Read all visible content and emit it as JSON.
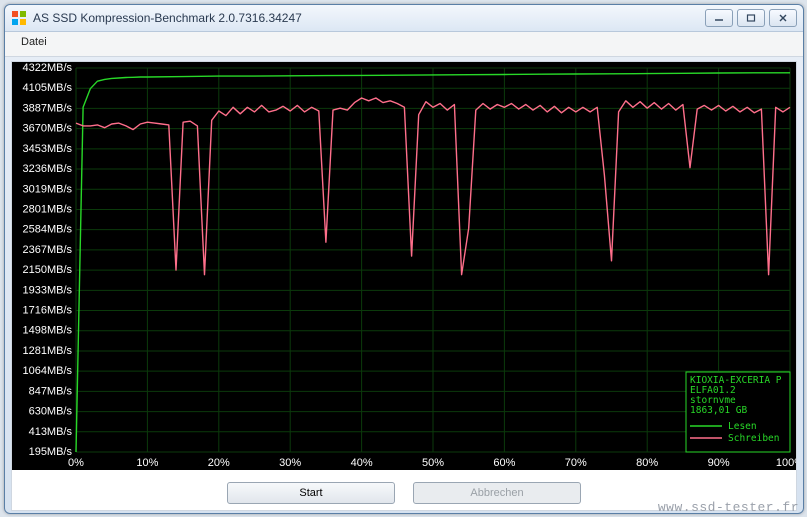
{
  "window": {
    "title": "AS SSD Kompression-Benchmark 2.0.7316.34247"
  },
  "menu": {
    "file": "Datei"
  },
  "buttons": {
    "start": "Start",
    "abort": "Abbrechen"
  },
  "watermark": "www.ssd-tester.fr",
  "legend": {
    "device_line1": "KIOXIA-EXCERIA P",
    "device_line2": "ELFA01.2",
    "driver": "stornvme",
    "capacity": "1863,01 GB",
    "read": "Lesen",
    "write": "Schreiben"
  },
  "colors": {
    "read": "#28d828",
    "write": "#ff6f8b",
    "grid": "#0b3a0b",
    "axis_text": "#ffffff",
    "legend_text": "#28d828"
  },
  "chart_data": {
    "type": "line",
    "title": "",
    "xlabel": "",
    "ylabel": "",
    "x_ticks": [
      "0%",
      "10%",
      "20%",
      "30%",
      "40%",
      "50%",
      "60%",
      "70%",
      "80%",
      "90%",
      "100%"
    ],
    "y_ticks": [
      "195MB/s",
      "413MB/s",
      "630MB/s",
      "847MB/s",
      "1064MB/s",
      "1281MB/s",
      "1498MB/s",
      "1716MB/s",
      "1933MB/s",
      "2150MB/s",
      "2367MB/s",
      "2584MB/s",
      "2801MB/s",
      "3019MB/s",
      "3236MB/s",
      "3453MB/s",
      "3670MB/s",
      "3887MB/s",
      "4105MB/s",
      "4322MB/s"
    ],
    "ylim": [
      195,
      4322
    ],
    "xlim": [
      0,
      100
    ],
    "series": [
      {
        "name": "Lesen",
        "color": "#28d828",
        "x": [
          0,
          1,
          2,
          3,
          4,
          5,
          6,
          7,
          8,
          9,
          10,
          15,
          20,
          25,
          30,
          35,
          40,
          45,
          50,
          55,
          60,
          65,
          70,
          75,
          80,
          85,
          90,
          95,
          100
        ],
        "y": [
          195,
          3900,
          4100,
          4180,
          4200,
          4210,
          4215,
          4220,
          4222,
          4225,
          4225,
          4230,
          4235,
          4235,
          4238,
          4240,
          4242,
          4245,
          4248,
          4250,
          4252,
          4255,
          4258,
          4260,
          4262,
          4265,
          4268,
          4270,
          4270
        ]
      },
      {
        "name": "Schreiben",
        "color": "#ff6f8b",
        "x": [
          0,
          1,
          2,
          3,
          4,
          5,
          6,
          7,
          8,
          9,
          10,
          11,
          12,
          13,
          14,
          15,
          16,
          17,
          18,
          19,
          20,
          21,
          22,
          23,
          24,
          25,
          26,
          27,
          28,
          29,
          30,
          31,
          32,
          33,
          34,
          35,
          36,
          37,
          38,
          39,
          40,
          41,
          42,
          43,
          44,
          45,
          46,
          47,
          48,
          49,
          50,
          51,
          52,
          53,
          54,
          55,
          56,
          57,
          58,
          59,
          60,
          61,
          62,
          63,
          64,
          65,
          66,
          67,
          68,
          69,
          70,
          71,
          72,
          73,
          74,
          75,
          76,
          77,
          78,
          79,
          80,
          81,
          82,
          83,
          84,
          85,
          86,
          87,
          88,
          89,
          90,
          91,
          92,
          93,
          94,
          95,
          96,
          97,
          98,
          99,
          100
        ],
        "y": [
          3730,
          3700,
          3700,
          3710,
          3680,
          3720,
          3730,
          3700,
          3660,
          3720,
          3740,
          3730,
          3720,
          3710,
          2150,
          3740,
          3750,
          3700,
          2100,
          3760,
          3860,
          3810,
          3900,
          3830,
          3900,
          3850,
          3920,
          3850,
          3870,
          3910,
          3860,
          3920,
          3850,
          3900,
          3860,
          2450,
          3870,
          3890,
          3870,
          3950,
          4000,
          3970,
          4000,
          3950,
          3970,
          3940,
          3900,
          2300,
          3820,
          3960,
          3900,
          3940,
          3870,
          3930,
          2100,
          2600,
          3870,
          3940,
          3880,
          3930,
          3900,
          3940,
          3880,
          3930,
          3870,
          3920,
          3850,
          3910,
          3840,
          3900,
          3850,
          3900,
          3850,
          3900,
          3170,
          2250,
          3850,
          3970,
          3900,
          3960,
          3890,
          3950,
          3880,
          3940,
          3870,
          3930,
          3250,
          3880,
          3920,
          3870,
          3920,
          3860,
          3910,
          3850,
          3900,
          3840,
          3880,
          2100,
          3900,
          3850,
          3900
        ]
      }
    ]
  }
}
